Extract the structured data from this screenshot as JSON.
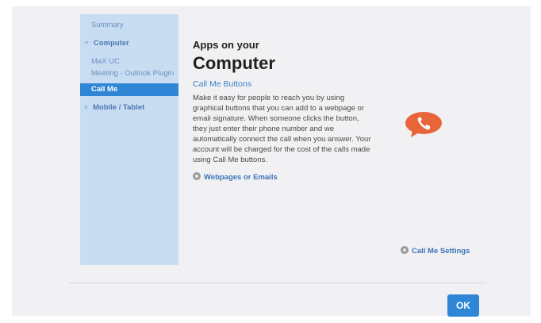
{
  "sidebar": {
    "summary": "Summary",
    "computer_section": "Computer",
    "computer_items": [
      "MaX UC",
      "Meeting - Outlook Plugin",
      "Call Me"
    ],
    "mobile_section": "Mobile / Tablet"
  },
  "content": {
    "subtitle": "Apps on your",
    "title": "Computer",
    "section_link": "Call Me Buttons",
    "description": "Make it easy for people to reach you by using graphical buttons that you can add to a webpage or email signature. When someone clicks the button, they just enter their phone number and we automatically connect the call when you answer. Your account will be charged for the cost of the calls made using Call Me buttons.",
    "webpages_link": "Webpages or Emails",
    "settings_link": "Call Me Settings",
    "icon": "phone-bubble-icon"
  },
  "footer": {
    "ok_label": "OK"
  },
  "colors": {
    "accent": "#2f86d6",
    "sidebar_bg": "#c9ddf2",
    "bubble": "#e8653a"
  }
}
